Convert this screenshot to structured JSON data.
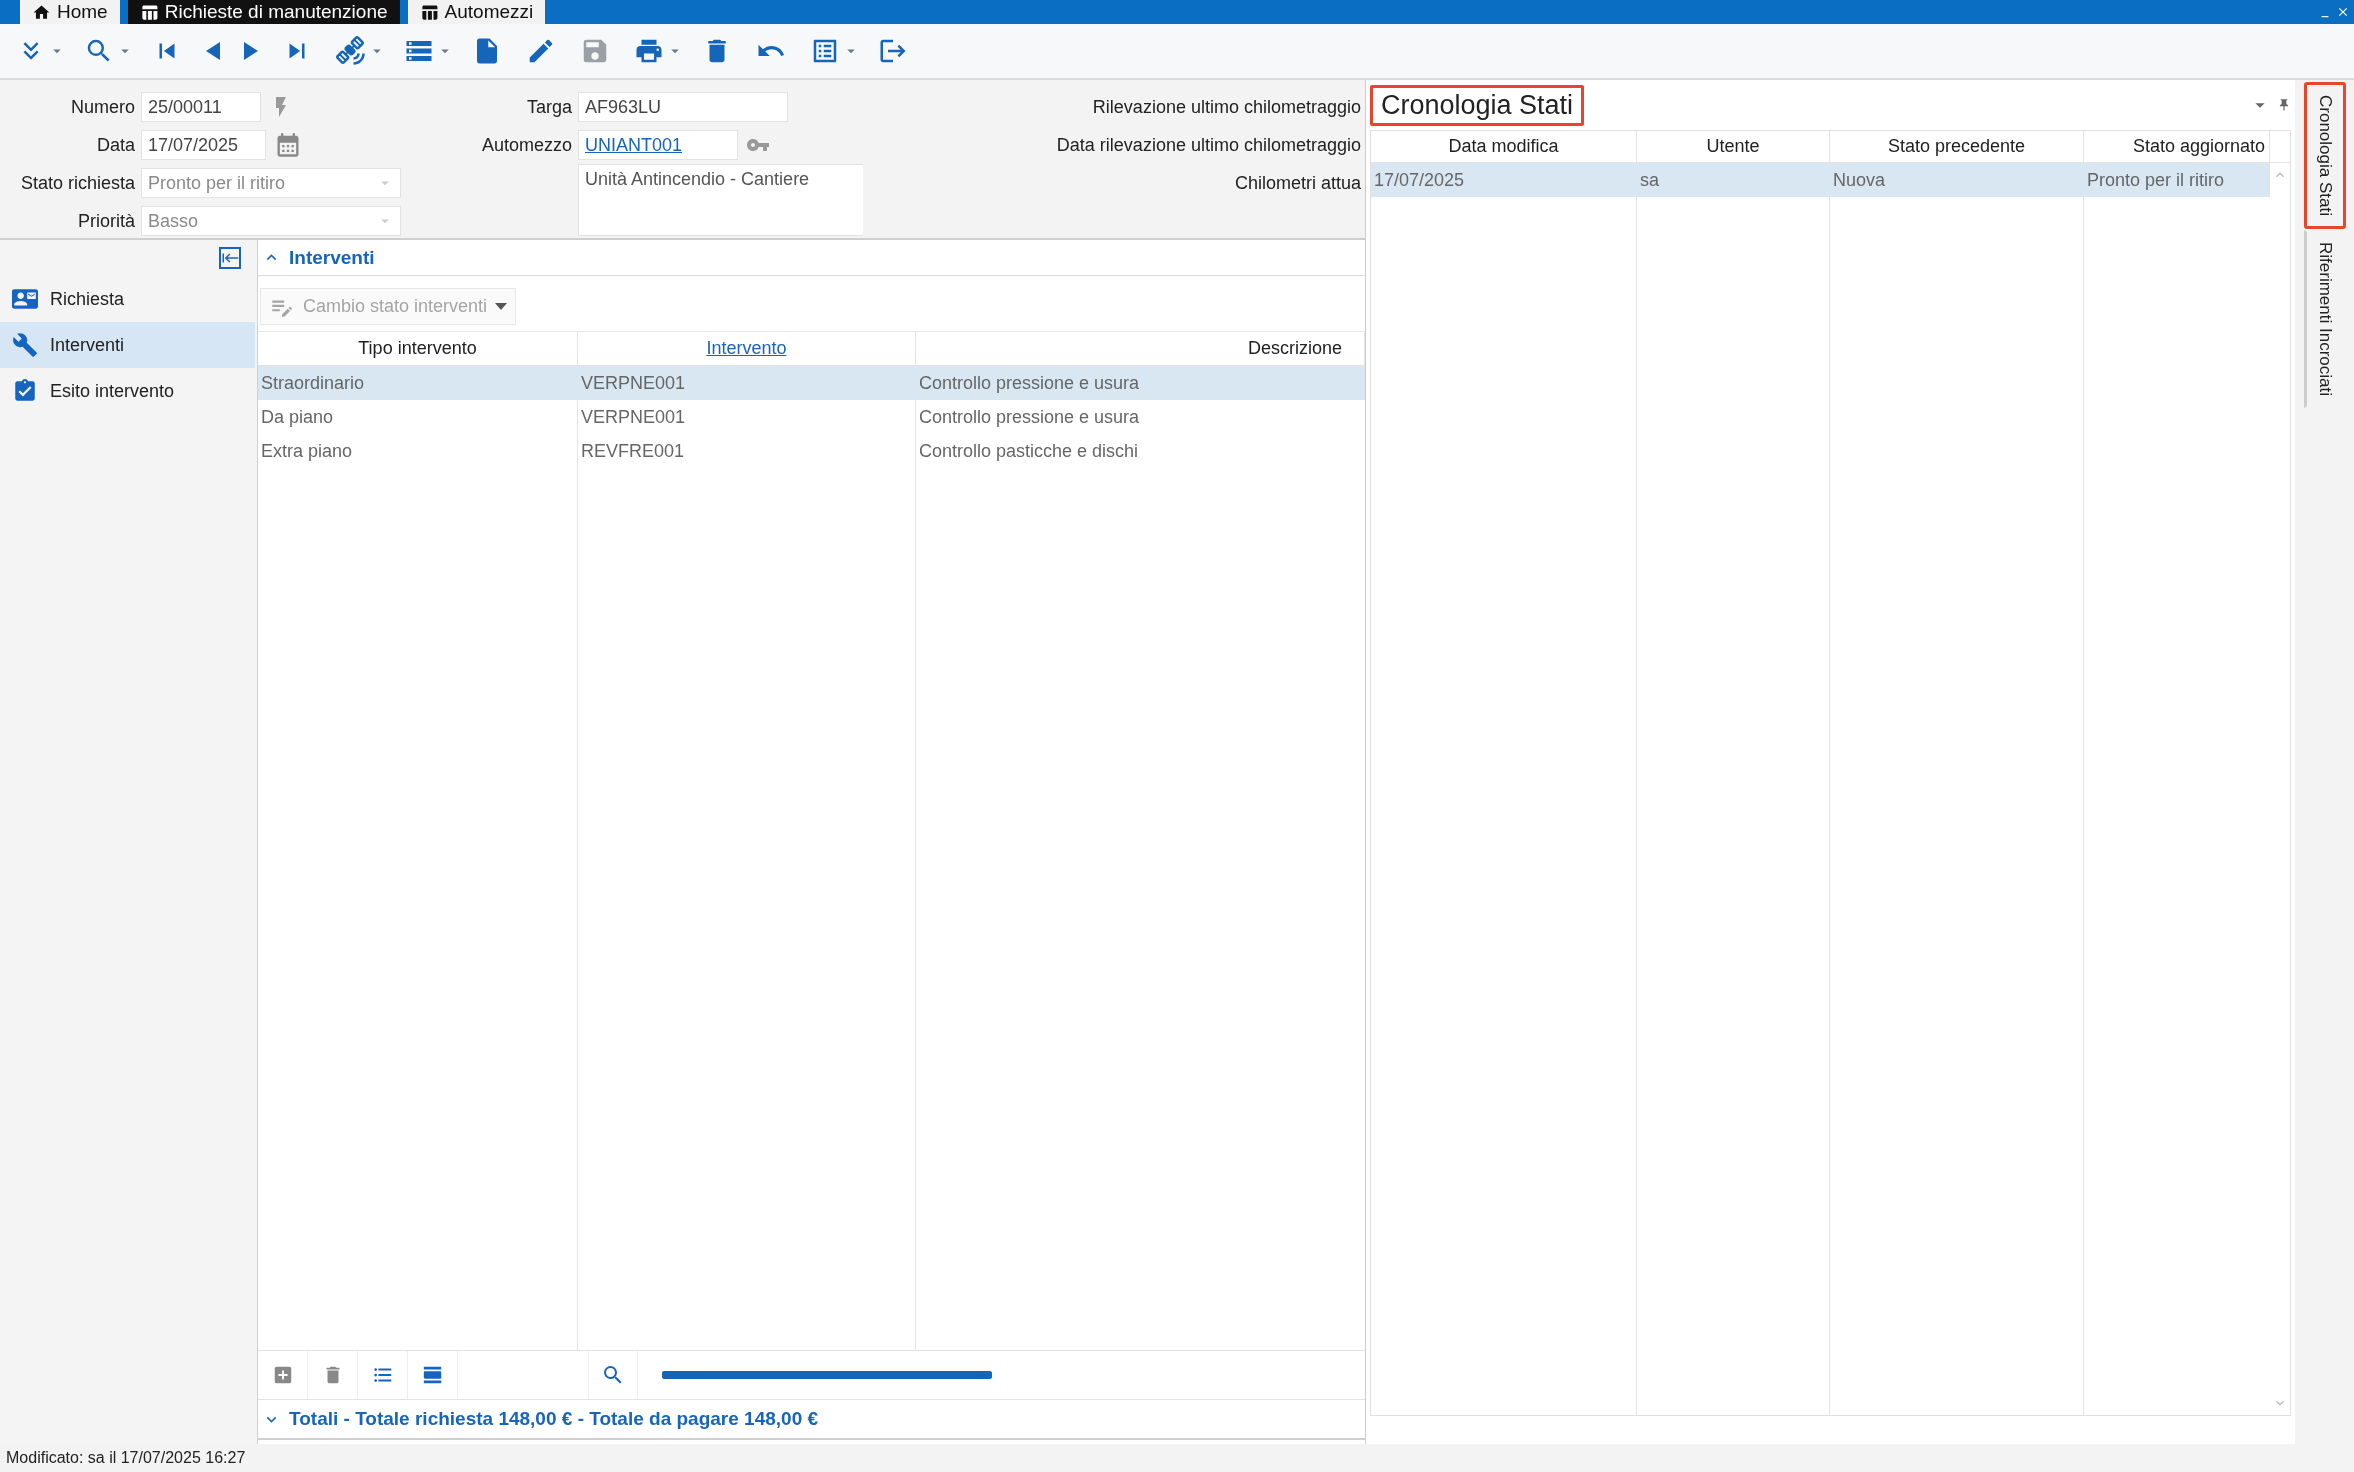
{
  "window_tabs": [
    {
      "label": "Home",
      "selected": false,
      "kind": "home"
    },
    {
      "label": "Richieste di manutenzione",
      "selected": true,
      "kind": "table"
    },
    {
      "label": "Automezzi",
      "selected": false,
      "kind": "table"
    }
  ],
  "toolbar": [
    {
      "kind": "expand",
      "dropdown": true,
      "disabled": false
    },
    {
      "kind": "search",
      "dropdown": true,
      "disabled": false
    },
    {
      "kind": "first",
      "dropdown": false,
      "disabled": false
    },
    {
      "kind": "prev",
      "dropdown": false,
      "disabled": false
    },
    {
      "kind": "next",
      "dropdown": false,
      "disabled": false
    },
    {
      "kind": "last",
      "dropdown": false,
      "disabled": false
    },
    {
      "kind": "satellite",
      "dropdown": true,
      "disabled": false
    },
    {
      "kind": "database",
      "dropdown": true,
      "disabled": false
    },
    {
      "kind": "new",
      "dropdown": false,
      "disabled": false
    },
    {
      "kind": "edit",
      "dropdown": false,
      "disabled": false
    },
    {
      "kind": "save",
      "dropdown": false,
      "disabled": true
    },
    {
      "kind": "print",
      "dropdown": true,
      "disabled": false
    },
    {
      "kind": "delete",
      "dropdown": false,
      "disabled": false
    },
    {
      "kind": "undo",
      "dropdown": false,
      "disabled": false
    },
    {
      "kind": "report",
      "dropdown": true,
      "disabled": false
    },
    {
      "kind": "exit",
      "dropdown": false,
      "disabled": false
    }
  ],
  "form": {
    "numero": {
      "label": "Numero",
      "value": "25/00011"
    },
    "data": {
      "label": "Data",
      "value": "17/07/2025"
    },
    "stato_richiesta": {
      "label": "Stato richiesta",
      "value": "Pronto per il ritiro",
      "disabled": true
    },
    "priorita": {
      "label": "Priorità",
      "value": "Basso",
      "disabled": true
    },
    "targa": {
      "label": "Targa",
      "value": "AF963LU"
    },
    "automezzo": {
      "label": "Automezzo",
      "value": "UNIANT001"
    },
    "descrizione_automezzo": "Unità Antincendio - Cantiere",
    "labels_right": [
      "Rilevazione ultimo chilometraggio",
      "Data rilevazione ultimo chilometraggio",
      "Chilometri attua"
    ]
  },
  "sidebar": {
    "items": [
      {
        "label": "Richiesta",
        "selected": false,
        "kind": "card"
      },
      {
        "label": "Interventi",
        "selected": true,
        "kind": "wrench"
      },
      {
        "label": "Esito intervento",
        "selected": false,
        "kind": "clipboard"
      }
    ]
  },
  "section": {
    "title": "Interventi",
    "expanded": true
  },
  "action_button": {
    "label": "Cambio stato interventi",
    "disabled": true
  },
  "grid": {
    "columns": [
      {
        "label": "Tipo intervento",
        "kind": "plain"
      },
      {
        "label": "Intervento",
        "kind": "link"
      },
      {
        "label": "Descrizione",
        "kind": "right"
      }
    ],
    "rows": [
      {
        "cells": [
          "Straordinario",
          "VERPNE001",
          "Controllo pressione e usura"
        ],
        "selected": true
      },
      {
        "cells": [
          "Da piano",
          "VERPNE001",
          "Controllo pressione e usura"
        ],
        "selected": false
      },
      {
        "cells": [
          "Extra piano",
          "REVFRE001",
          "Controllo pasticche e dischi"
        ],
        "selected": false
      }
    ]
  },
  "totals": {
    "title": "Totali - Totale richiesta 148,00 € - Totale da pagare 148,00 €",
    "expanded": false
  },
  "history_panel": {
    "title": "Cronologia Stati",
    "highlighted": true,
    "columns": [
      "Data modifica",
      "Utente",
      "Stato precedente",
      "Stato aggiornato"
    ],
    "rows": [
      {
        "cells": [
          "17/07/2025",
          "sa",
          "Nuova",
          "Pronto per il ritiro"
        ],
        "selected": true
      }
    ]
  },
  "side_tabs": [
    {
      "label": "Cronologia Stati",
      "selected": true
    },
    {
      "label": "Riferimenti Incrociati",
      "selected": false
    }
  ],
  "status_bar": "Modificato: sa il 17/07/2025 16:27"
}
